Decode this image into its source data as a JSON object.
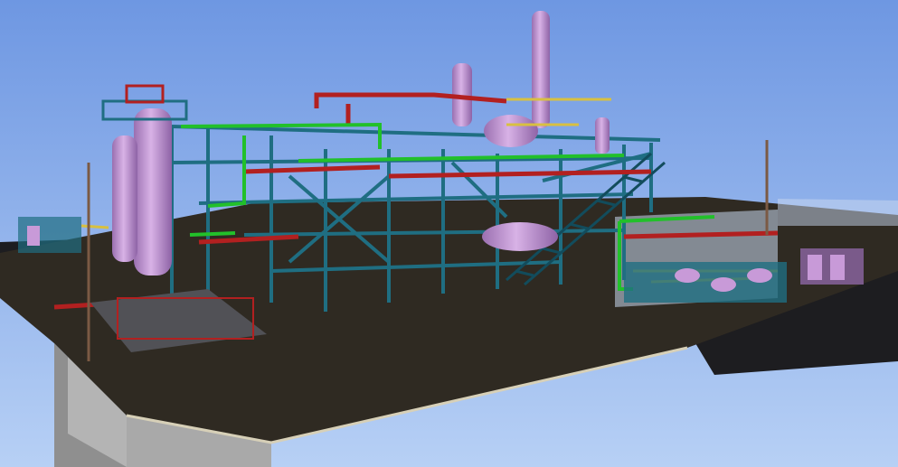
{
  "scene": {
    "colors": {
      "sky_top": "#6e97e2",
      "sky_bottom": "#b7d0f5",
      "slab": "#2f2a22",
      "slab_edge": "#7a7a7a",
      "road": "#1d1d20",
      "steel": "#1f6e82",
      "steel_dark": "#124c5c",
      "vessel": "#c89ad8",
      "vessel_dark": "#9a6fb0",
      "pipe_red": "#b22020",
      "pipe_green": "#22c02a",
      "pipe_yellow": "#d8c040",
      "glass": "#c9d8f0"
    },
    "icons": [
      "light-pole-icon"
    ]
  }
}
